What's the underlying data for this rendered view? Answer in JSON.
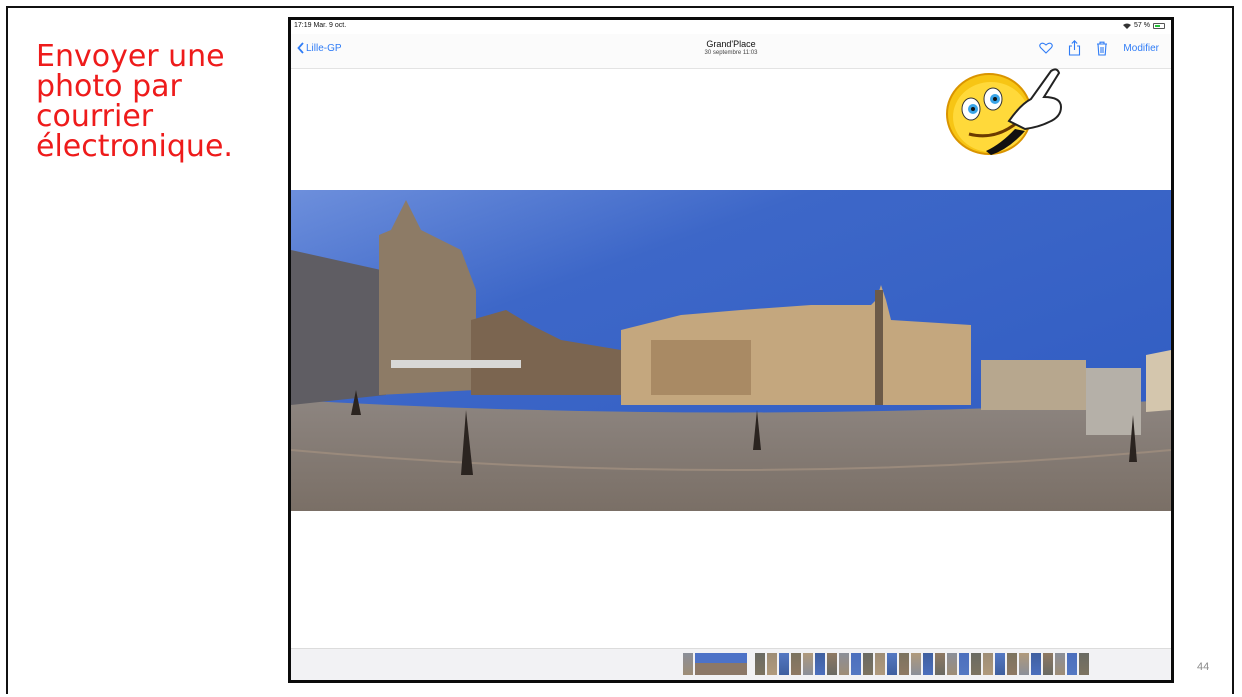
{
  "slide": {
    "title": "Envoyer une\nphoto par\ncourrier\nélectronique.",
    "page_number": "44",
    "title_color": "#ee1b1b"
  },
  "ipad": {
    "status_bar": {
      "time": "17:19  Mar. 9 oct.",
      "battery": "57 %",
      "battery_level": 0.57
    },
    "navbar": {
      "back_label": "Lille-GP",
      "title": "Grand'Place",
      "subtitle": "30 septembre  11:03",
      "edit_label": "Modifier",
      "accent_color": "#2f7cf6",
      "icons": [
        "heart-icon",
        "share-icon",
        "trash-icon"
      ]
    },
    "photo": {
      "description_icon": "panorama-photo",
      "sky_color": "#3d67c8"
    },
    "thumbnail_strip": {
      "count": 30,
      "selected_index": 1
    }
  },
  "overlay": {
    "icon": "pointing-smiley-icon"
  }
}
